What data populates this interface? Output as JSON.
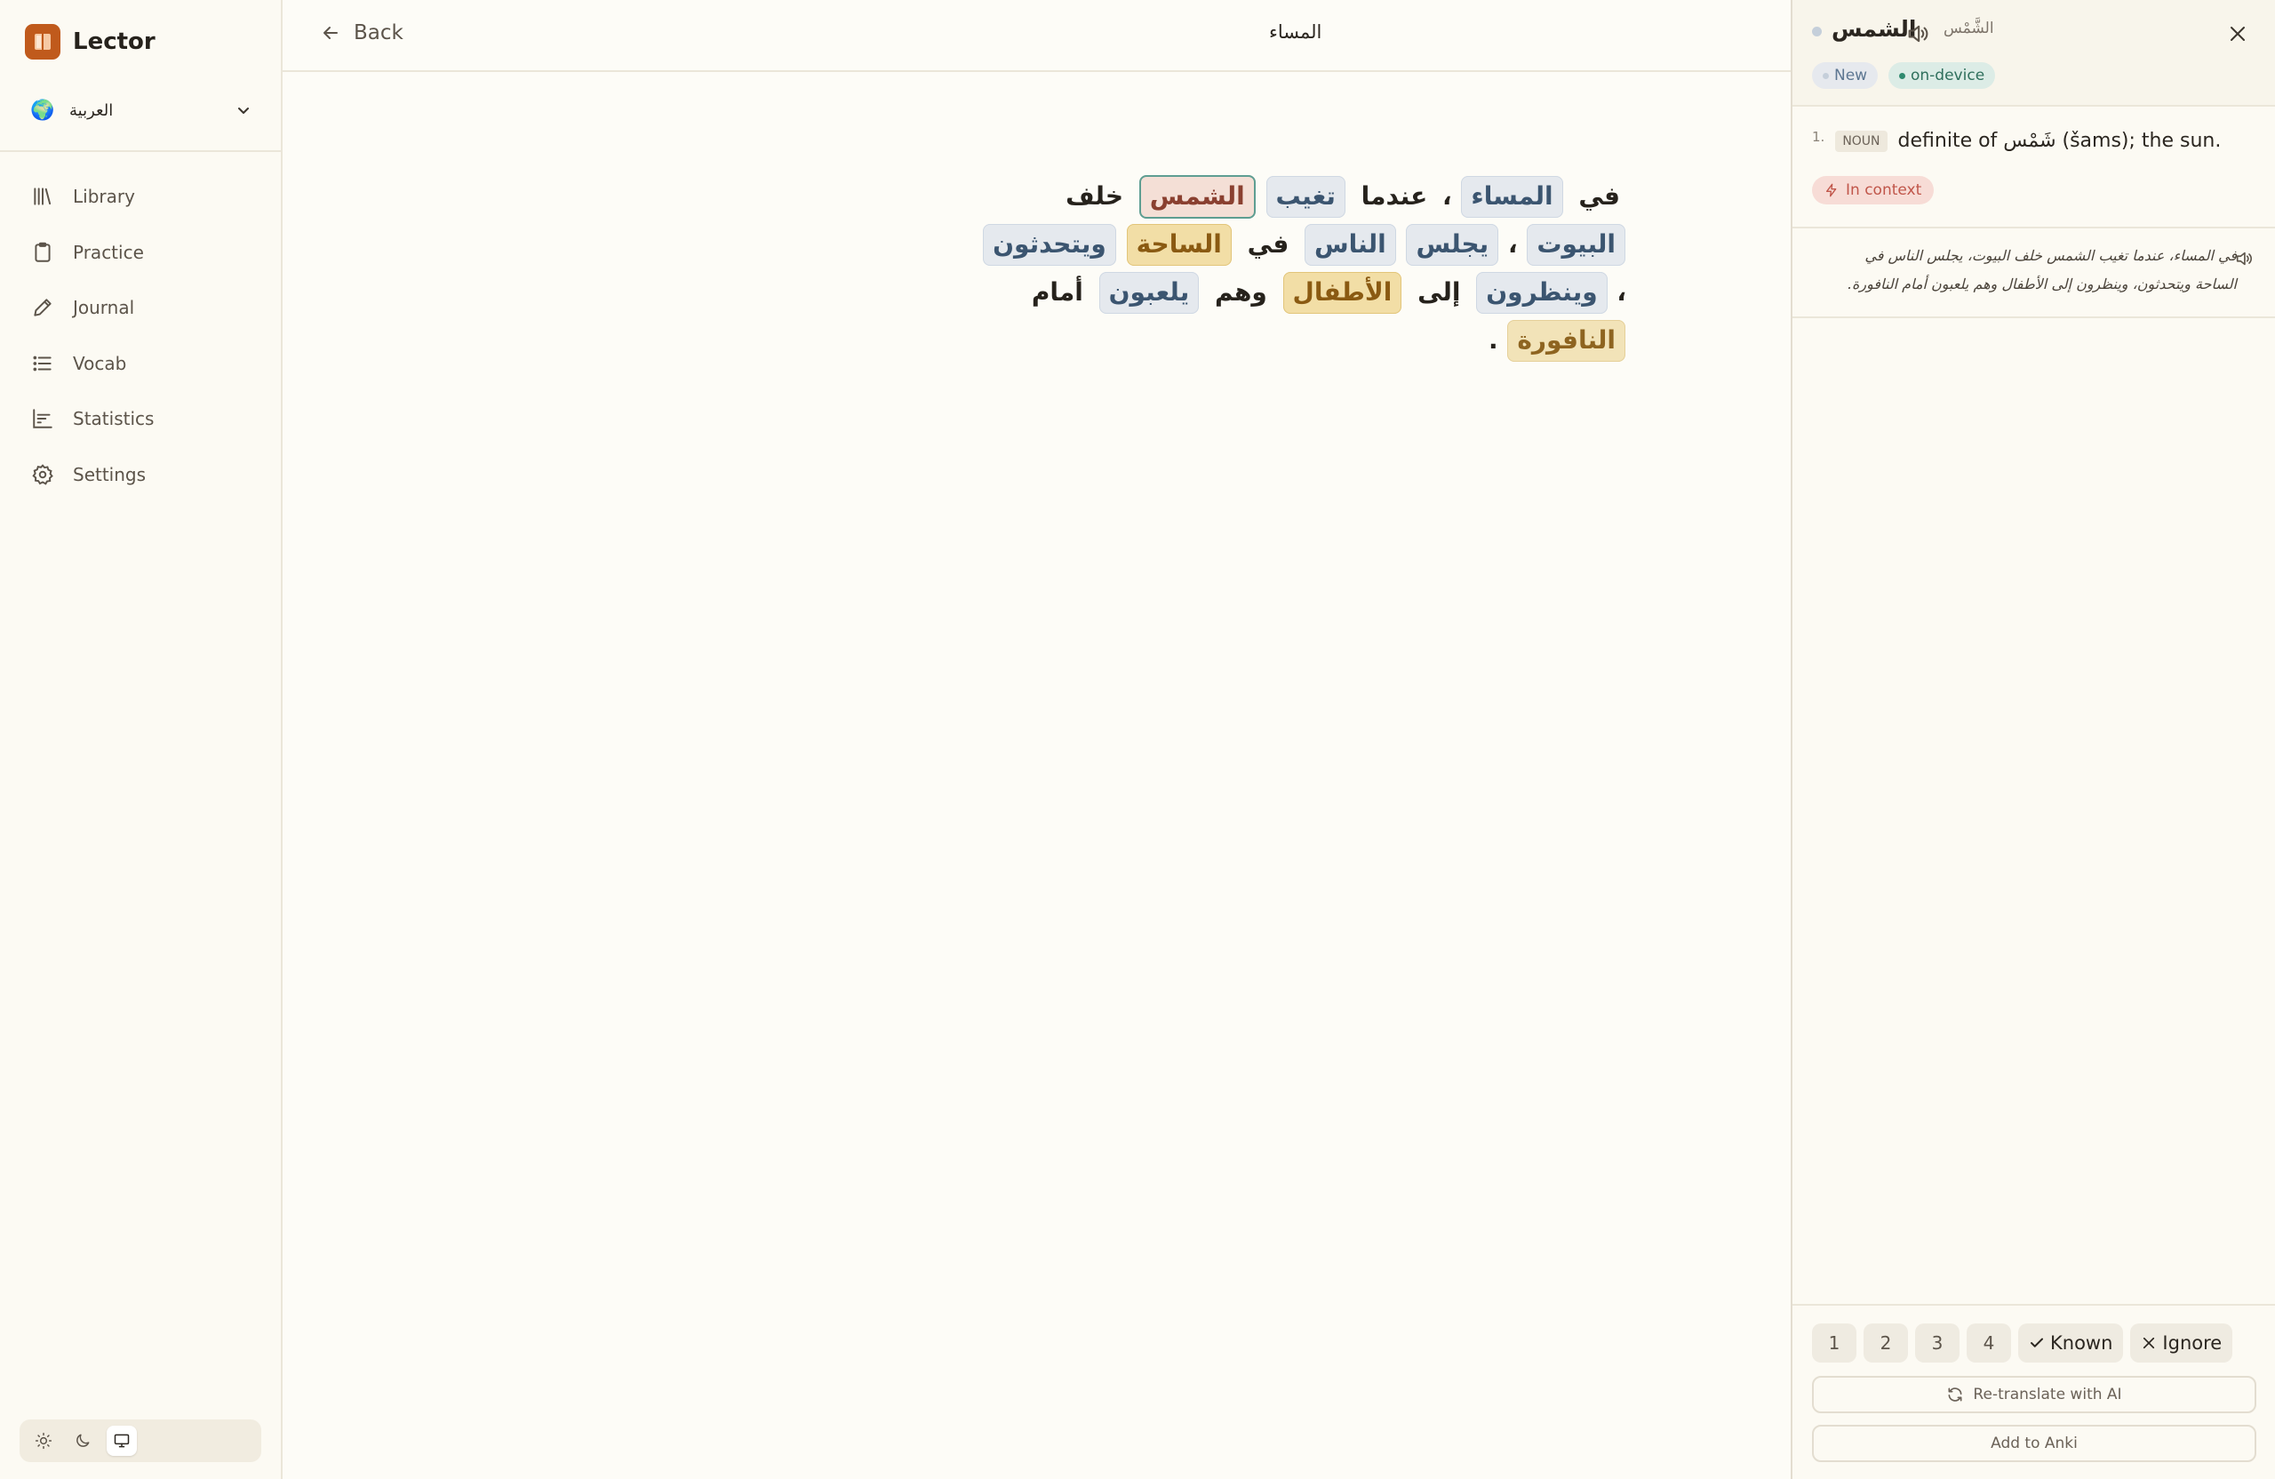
{
  "brand": {
    "name": "Lector",
    "accent": "#c05a1c"
  },
  "language": {
    "flag": "🌍",
    "name": "العربية"
  },
  "nav": [
    {
      "id": "library",
      "label": "Library",
      "icon": "library-icon"
    },
    {
      "id": "practice",
      "label": "Practice",
      "icon": "clipboard-icon"
    },
    {
      "id": "journal",
      "label": "Journal",
      "icon": "pencil-icon"
    },
    {
      "id": "vocab",
      "label": "Vocab",
      "icon": "list-icon"
    },
    {
      "id": "statistics",
      "label": "Statistics",
      "icon": "bar-chart-icon"
    },
    {
      "id": "settings",
      "label": "Settings",
      "icon": "gear-icon"
    }
  ],
  "theme": {
    "options": [
      "light",
      "dark",
      "system"
    ],
    "selected": "system"
  },
  "header": {
    "back_label": "Back",
    "title": "المساء"
  },
  "reader": {
    "words": [
      {
        "text": "في",
        "status": "known"
      },
      {
        "text": "المساء",
        "status": "new"
      },
      {
        "text": "،",
        "status": "punct"
      },
      {
        "text": "عندما",
        "status": "known"
      },
      {
        "text": "تغيب",
        "status": "new"
      },
      {
        "text": "الشمس",
        "status": "selected"
      },
      {
        "text": "خلف",
        "status": "known"
      },
      {
        "text": "البيوت",
        "status": "new"
      },
      {
        "text": "،",
        "status": "punct"
      },
      {
        "text": "يجلس",
        "status": "new"
      },
      {
        "text": "الناس",
        "status": "new"
      },
      {
        "text": "في",
        "status": "known"
      },
      {
        "text": "الساحة",
        "status": "learning"
      },
      {
        "text": "ويتحدثون",
        "status": "new"
      },
      {
        "text": "،",
        "status": "punct"
      },
      {
        "text": "وينظرون",
        "status": "new"
      },
      {
        "text": "إلى",
        "status": "known"
      },
      {
        "text": "الأطفال",
        "status": "learning"
      },
      {
        "text": "وهم",
        "status": "known"
      },
      {
        "text": "يلعبون",
        "status": "new"
      },
      {
        "text": "أمام",
        "status": "known"
      },
      {
        "text": "النافورة",
        "status": "learning-light"
      },
      {
        "text": ".",
        "status": "punct"
      }
    ]
  },
  "panel": {
    "word": "الشمس",
    "lemma": "الشَّمْس",
    "badges": {
      "status": "New",
      "source": "on-device"
    },
    "definitions": [
      {
        "num": "1.",
        "pos": "NOUN",
        "text": "definite of شَمْس (šams); the sun."
      }
    ],
    "context_label": "In context",
    "context_sentence": "في المساء، عندما تغيب الشمس خلف البيوت، يجلس الناس في الساحة ويتحدثون، وينظرون إلى الأطفال وهم يلعبون أمام النافورة.",
    "ratings": [
      "1",
      "2",
      "3",
      "4"
    ],
    "known_label": "Known",
    "ignore_label": "Ignore",
    "retranslate_label": "Re-translate with AI",
    "anki_label": "Add to Anki"
  }
}
